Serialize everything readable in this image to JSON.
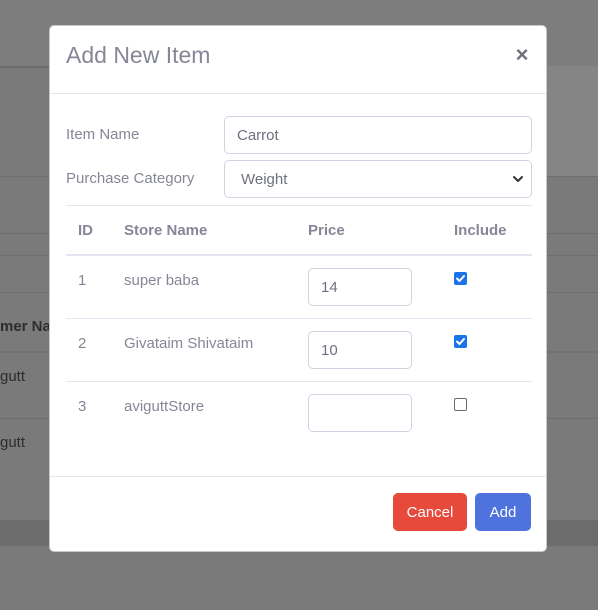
{
  "background": {
    "column_header_partial": "mer Na",
    "row_values": [
      "gutt",
      "gutt"
    ]
  },
  "modal": {
    "title": "Add New Item",
    "close_symbol": "×",
    "item_name": {
      "label": "Item Name",
      "value": "Carrot"
    },
    "purchase_category": {
      "label": "Purchase Category",
      "selected": "Weight"
    },
    "table": {
      "headers": {
        "id": "ID",
        "store_name": "Store Name",
        "price": "Price",
        "include": "Include"
      },
      "rows": [
        {
          "id": "1",
          "store_name": "super baba",
          "price": "14",
          "include": true
        },
        {
          "id": "2",
          "store_name": "Givataim Shivataim",
          "price": "10",
          "include": true
        },
        {
          "id": "3",
          "store_name": "aviguttStore",
          "price": "",
          "include": false
        }
      ]
    },
    "footer": {
      "cancel_label": "Cancel",
      "add_label": "Add"
    }
  },
  "colors": {
    "cancel": "#e74a3b",
    "add": "#4e73df",
    "checkbox_on": "#1a73e8",
    "text": "#858796"
  },
  "icons": {
    "close": "close-icon",
    "select_chevron": "chevron-down-icon",
    "checkbox_check": "check-icon"
  }
}
